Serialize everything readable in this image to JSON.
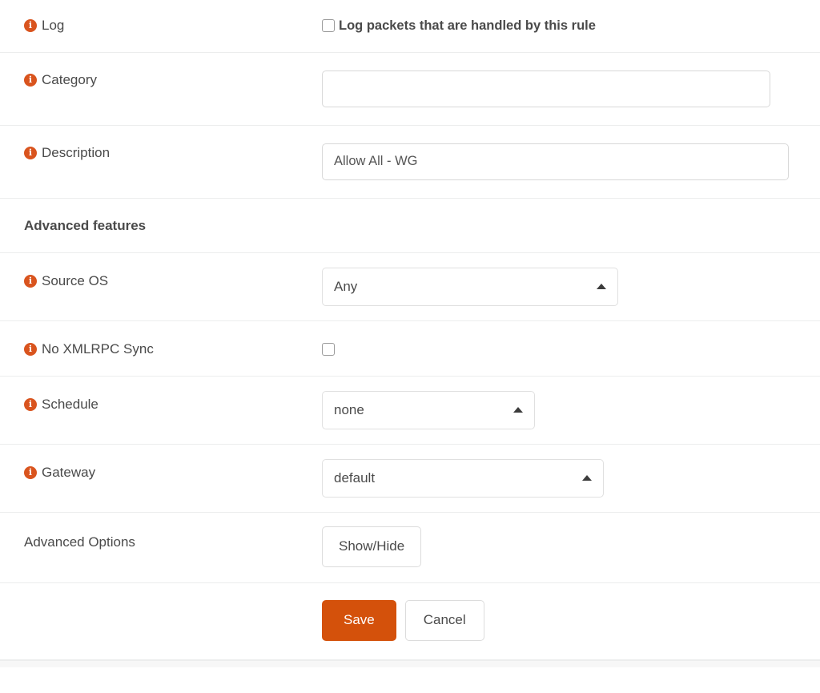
{
  "form": {
    "rows": [
      {
        "id": "log",
        "label": "Log",
        "has_info_icon": true,
        "control": "checkbox",
        "checkbox_label": "Log packets that are handled by this rule",
        "checked": false
      },
      {
        "id": "category",
        "label": "Category",
        "has_info_icon": true,
        "control": "text",
        "value": "",
        "placeholder": ""
      },
      {
        "id": "description",
        "label": "Description",
        "has_info_icon": true,
        "control": "text",
        "value": "Allow All - WG",
        "placeholder": ""
      }
    ],
    "section_heading": "Advanced features",
    "advanced_rows": [
      {
        "id": "source-os",
        "label": "Source OS",
        "has_info_icon": true,
        "control": "select",
        "value": "Any"
      },
      {
        "id": "no-xmlrpc-sync",
        "label": "No XMLRPC Sync",
        "has_info_icon": true,
        "control": "checkbox",
        "checkbox_label": "",
        "checked": false
      },
      {
        "id": "schedule",
        "label": "Schedule",
        "has_info_icon": true,
        "control": "select",
        "value": "none"
      },
      {
        "id": "gateway",
        "label": "Gateway",
        "has_info_icon": true,
        "control": "select",
        "value": "default"
      },
      {
        "id": "advanced-options",
        "label": "Advanced Options",
        "has_info_icon": false,
        "control": "button",
        "button_label": "Show/Hide"
      }
    ],
    "actions": {
      "save_label": "Save",
      "cancel_label": "Cancel"
    }
  },
  "icons": {
    "info_glyph": "i",
    "caret_direction": "up"
  },
  "colors": {
    "accent": "#d4510b",
    "info_icon": "#d9541e",
    "text": "#4a4a4a",
    "divider": "#eceded",
    "input_border": "#d8d8d8"
  }
}
